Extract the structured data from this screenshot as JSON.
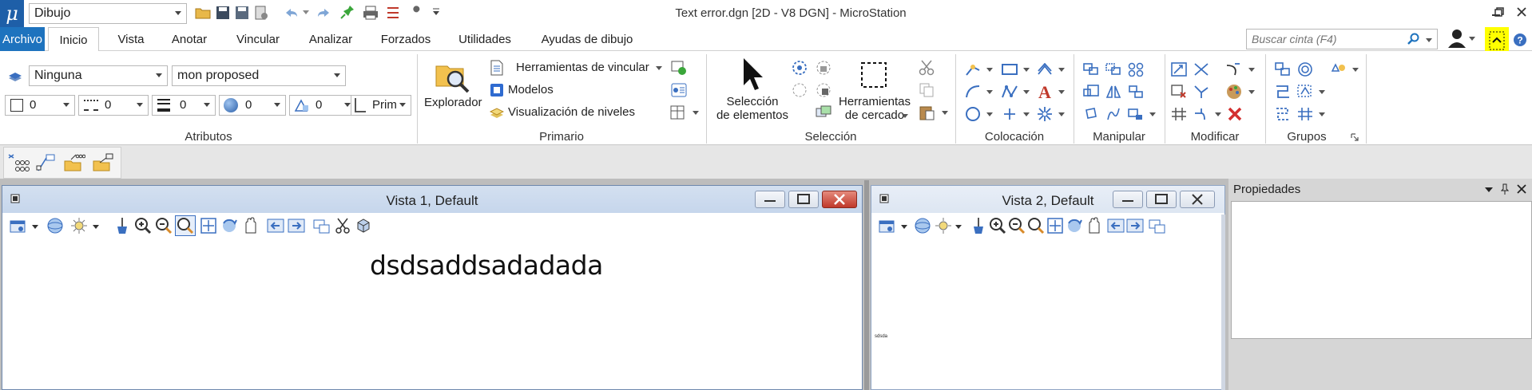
{
  "titlebar": {
    "title": "Text error.dgn [2D - V8 DGN] - MicroStation",
    "workflow": "Dibujo",
    "app_logo": "μ"
  },
  "tabs": [
    {
      "label": "Archivo"
    },
    {
      "label": "Inicio"
    },
    {
      "label": "Vista"
    },
    {
      "label": "Anotar"
    },
    {
      "label": "Vincular"
    },
    {
      "label": "Analizar"
    },
    {
      "label": "Forzados"
    },
    {
      "label": "Utilidades"
    },
    {
      "label": "Ayudas de dibujo"
    }
  ],
  "search": {
    "placeholder": "Buscar cinta (F4)"
  },
  "attributes": {
    "level": "Ninguna",
    "style": "mon proposed",
    "color": "0",
    "line_style": "0",
    "weight": "0",
    "transparency": "0",
    "priority": "0",
    "class": "Prim"
  },
  "primario": {
    "explorer": "Explorador",
    "attach_tools": "Herramientas de vincular",
    "models": "Modelos",
    "level_display": "Visualización de niveles"
  },
  "seleccion": {
    "select_l1": "Selección",
    "select_l2": "de elementos",
    "fence_l1": "Herramientas",
    "fence_l2": "de cercado"
  },
  "groups": {
    "atributos": "Atributos",
    "primario": "Primario",
    "seleccion": "Selección",
    "colocacion": "Colocación",
    "manipular": "Manipular",
    "modificar": "Modificar",
    "grupos": "Grupos"
  },
  "views": {
    "view1_title": "Vista 1, Default",
    "view2_title": "Vista 2, Default",
    "view1_text": "dsdsaddsadadada",
    "view2_text": "sdsda"
  },
  "properties": {
    "title": "Propiedades"
  },
  "colors": {
    "accent": "#1e73be",
    "tab_active_bg": "#ffffff",
    "highlight": "#ffff00"
  }
}
